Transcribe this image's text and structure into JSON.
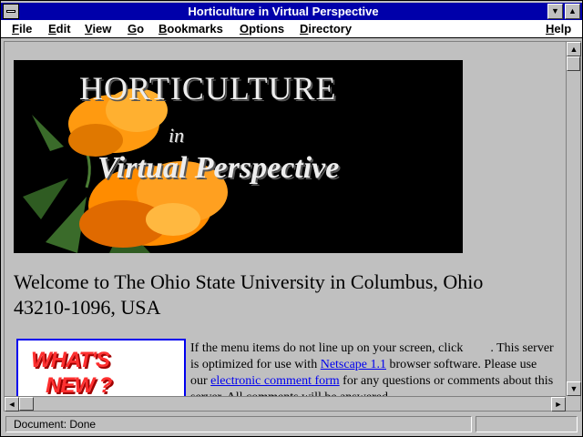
{
  "window": {
    "title": "Horticulture in Virtual Perspective",
    "minimize_glyph": "▼",
    "maximize_glyph": "▲"
  },
  "menu": {
    "items": [
      {
        "label": "File",
        "accel": "F",
        "rest": "ile"
      },
      {
        "label": "Edit",
        "accel": "E",
        "rest": "dit"
      },
      {
        "label": "View",
        "accel": "V",
        "rest": "iew"
      },
      {
        "label": "Go",
        "accel": "G",
        "rest": "o"
      },
      {
        "label": "Bookmarks",
        "accel": "B",
        "rest": "ookmarks"
      },
      {
        "label": "Options",
        "accel": "O",
        "rest": "ptions"
      },
      {
        "label": "Directory",
        "accel": "D",
        "rest": "irectory"
      },
      {
        "label": "Help",
        "accel": "H",
        "rest": "elp"
      }
    ]
  },
  "page": {
    "banner": {
      "line1": "HORTICULTURE",
      "line2": "in",
      "line3": "Virtual Perspective"
    },
    "welcome": "Welcome to The Ohio State University in Columbus, Ohio 43210-1096, USA",
    "whats_new": {
      "line1": "WHAT'S",
      "line2": "NEW ?"
    },
    "intro": {
      "text1": "If the menu items do not line up on your screen, click",
      "text2": ". This server is optimized for use with",
      "link1": "Netscape 1.1",
      "text3": "browser software. Please use our",
      "link2": "electronic comment form",
      "text4": "for any questions or comments about this server. All comments will be answered."
    }
  },
  "scrollbars": {
    "up": "▲",
    "down": "▼",
    "left": "◄",
    "right": "►"
  },
  "status": {
    "text": "Document: Done"
  },
  "colors": {
    "titlebar": "#0000aa",
    "link": "#0000ee",
    "chrome": "#c0c0c0",
    "flower": "#ff8c00"
  }
}
